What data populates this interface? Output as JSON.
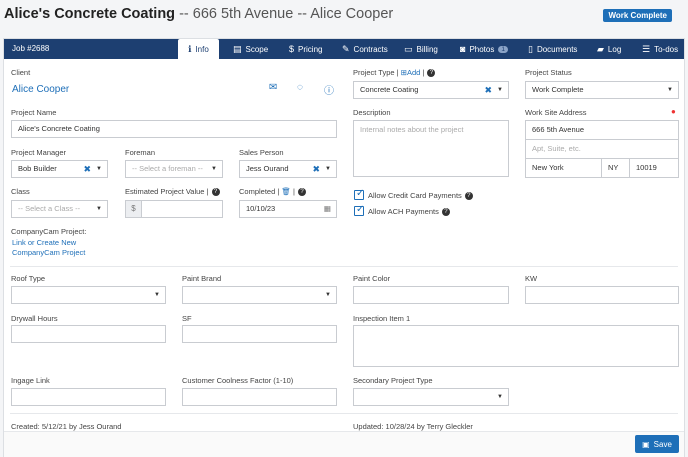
{
  "header": {
    "client_bold": "Alice's Concrete Coating",
    "rest": " -- 666 5th Avenue -- Alice Cooper",
    "status": "Work Complete"
  },
  "tabs": {
    "job": "Job #2688",
    "items": [
      {
        "label": "Info",
        "icon": "info-icon"
      },
      {
        "label": "Scope",
        "icon": "list-icon"
      },
      {
        "label": "Pricing",
        "icon": "dollar-icon"
      },
      {
        "label": "Contracts",
        "icon": "edit-icon"
      },
      {
        "label": "Billing",
        "icon": "card-icon"
      },
      {
        "label": "Photos",
        "icon": "camera-icon",
        "badge": "1"
      },
      {
        "label": "Documents",
        "icon": "document-icon"
      },
      {
        "label": "Log",
        "icon": "chat-icon"
      },
      {
        "label": "To-dos",
        "icon": "checklist-icon"
      }
    ]
  },
  "form": {
    "client_label": "Client",
    "client_name": "Alice Cooper",
    "project_name_label": "Project Name",
    "project_name": "Alice's Concrete Coating",
    "pm_label": "Project Manager",
    "pm_value": "Bob Builder",
    "foreman_label": "Foreman",
    "foreman_placeholder": "-- Select a foreman --",
    "sales_label": "Sales Person",
    "sales_value": "Jess Ourand",
    "class_label": "Class",
    "class_placeholder": "-- Select a Class --",
    "est_value_label": "Estimated Project Value",
    "currency": "$",
    "completed_label": "Completed",
    "completed_value": "10/10/23",
    "companycam_label": "CompanyCam Project:",
    "companycam_link1": "Link or Create New",
    "companycam_link2": "CompanyCam Project",
    "project_type_label": "Project Type",
    "add_label": "Add",
    "project_type_value": "Concrete Coating",
    "description_label": "Description",
    "description_placeholder": "Internal notes about the project",
    "allow_cc": "Allow Credit Card Payments",
    "allow_ach": "Allow ACH Payments",
    "status_label": "Project Status",
    "status_value": "Work Complete",
    "address_label": "Work Site Address",
    "address1": "666 5th Avenue",
    "address2_placeholder": "Apt, Suite, etc.",
    "city": "New York",
    "state": "NY",
    "zip": "10019",
    "roof_type_label": "Roof Type",
    "paint_brand_label": "Paint Brand",
    "paint_color_label": "Paint Color",
    "kw_label": "KW",
    "drywall_label": "Drywall Hours",
    "sf_label": "SF",
    "inspection_label": "Inspection Item 1",
    "ingage_label": "Ingage Link",
    "coolness_label": "Customer Coolness Factor (1-10)",
    "secondary_type_label": "Secondary Project Type"
  },
  "meta": {
    "created": "Created: 5/12/21  by Jess Ourand",
    "updated": "Updated: 10/28/24  by Terry Gleckler"
  },
  "save_label": "Save"
}
